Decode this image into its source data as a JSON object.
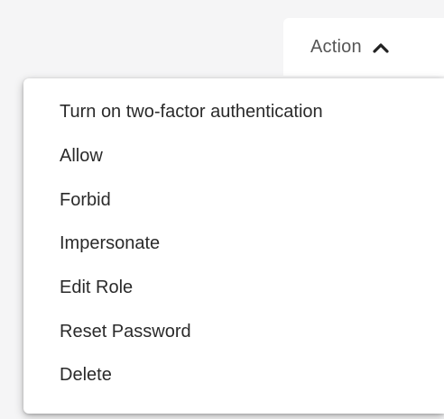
{
  "action_button": {
    "label": "Action",
    "icon": "chevron-up-icon"
  },
  "menu": {
    "items": [
      {
        "label": "Turn on two-factor authentication"
      },
      {
        "label": "Allow"
      },
      {
        "label": "Forbid"
      },
      {
        "label": "Impersonate"
      },
      {
        "label": "Edit Role"
      },
      {
        "label": "Reset Password"
      },
      {
        "label": "Delete"
      }
    ]
  }
}
